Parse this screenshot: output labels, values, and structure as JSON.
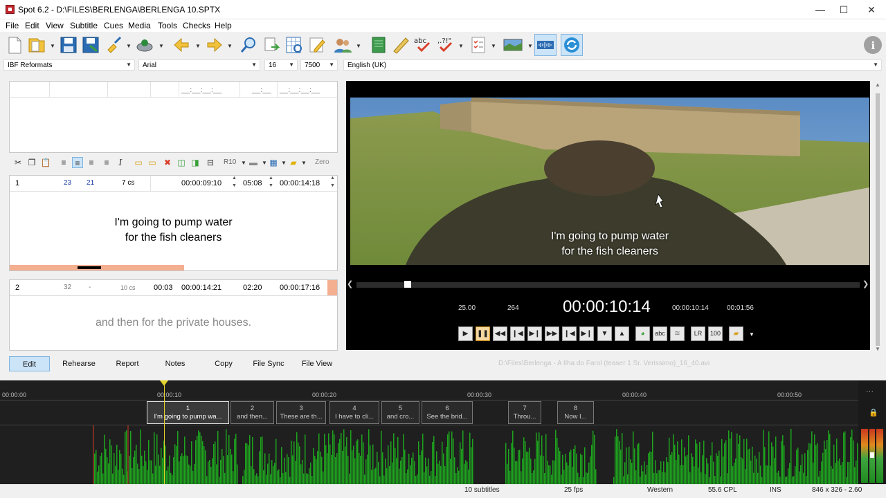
{
  "window": {
    "title": "Spot 6.2 - D:\\FILES\\BERLENGA\\BERLENGA 10.SPTX",
    "minimize": "—",
    "maximize": "☐",
    "close": "✕"
  },
  "menu": [
    "File",
    "Edit",
    "View",
    "Subtitle",
    "Cues",
    "Media",
    "Tools",
    "Checks",
    "Help"
  ],
  "format": {
    "style": "IBF Reformats",
    "font": "Arial",
    "size": "16",
    "value": "7500",
    "language": "English (UK)"
  },
  "top_grid": {
    "tc_in": "__:__:__:__",
    "dur": "__:__",
    "tc_out": "__:__:__:__"
  },
  "edit_toolbar": {
    "r10": "R10",
    "zero": "Zero"
  },
  "current_subtitle": {
    "number": "1",
    "chars": "23",
    "chars2": "21",
    "cs": "7 cs",
    "tc_in": "00:00:09:10",
    "duration": "05:08",
    "tc_out": "00:00:14:18",
    "line1": "I'm going to pump water",
    "line2": "for the fish cleaners"
  },
  "next_subtitle": {
    "number": "2",
    "chars": "32",
    "dash": "-",
    "cs": "10 cs",
    "gap": "00:03",
    "tc_in": "00:00:14:21",
    "duration": "02:20",
    "tc_out": "00:00:17:16",
    "text": "and then for the private houses."
  },
  "tabs": [
    "Edit",
    "Rehearse",
    "Report",
    "Notes",
    "Copy",
    "File Sync",
    "File View"
  ],
  "media_file": "D:\\Files\\Berlenga - A Ilha do Farol (teaser 1 Sr. Verissimo)_16_40.avi",
  "player": {
    "fps": "25.00",
    "frame": "264",
    "timecode": "00:00:10:14",
    "tc_small": "00:00:10:14",
    "total": "00:01:56",
    "caption1": "I'm going to pump water",
    "caption2": "for the fish cleaners",
    "lr": "LR",
    "hundred": "100",
    "abc": "abc"
  },
  "timeline": {
    "ticks": [
      "00:00:00",
      "00:00:10",
      "00:00:20",
      "00:00:30",
      "00:00:40",
      "00:00:50"
    ],
    "subtitles": [
      {
        "n": "1",
        "t": "I'm going to pump wa..."
      },
      {
        "n": "2",
        "t": "and then..."
      },
      {
        "n": "3",
        "t": "These are th..."
      },
      {
        "n": "4",
        "t": "I have to cli..."
      },
      {
        "n": "5",
        "t": "and cro..."
      },
      {
        "n": "6",
        "t": "See the brid..."
      },
      {
        "n": "7",
        "t": "Throu..."
      },
      {
        "n": "8",
        "t": "Now I..."
      }
    ],
    "more": "···"
  },
  "status": {
    "count": "10 subtitles",
    "fps": "25 fps",
    "charset": "Western",
    "cpl": "55.6 CPL",
    "mode": "INS",
    "size": "846 x 326 - 2.60"
  },
  "colors": {
    "accent": "#cce4f7",
    "bar_progress": "#f4ae90",
    "waveform": "#1ea31e"
  }
}
